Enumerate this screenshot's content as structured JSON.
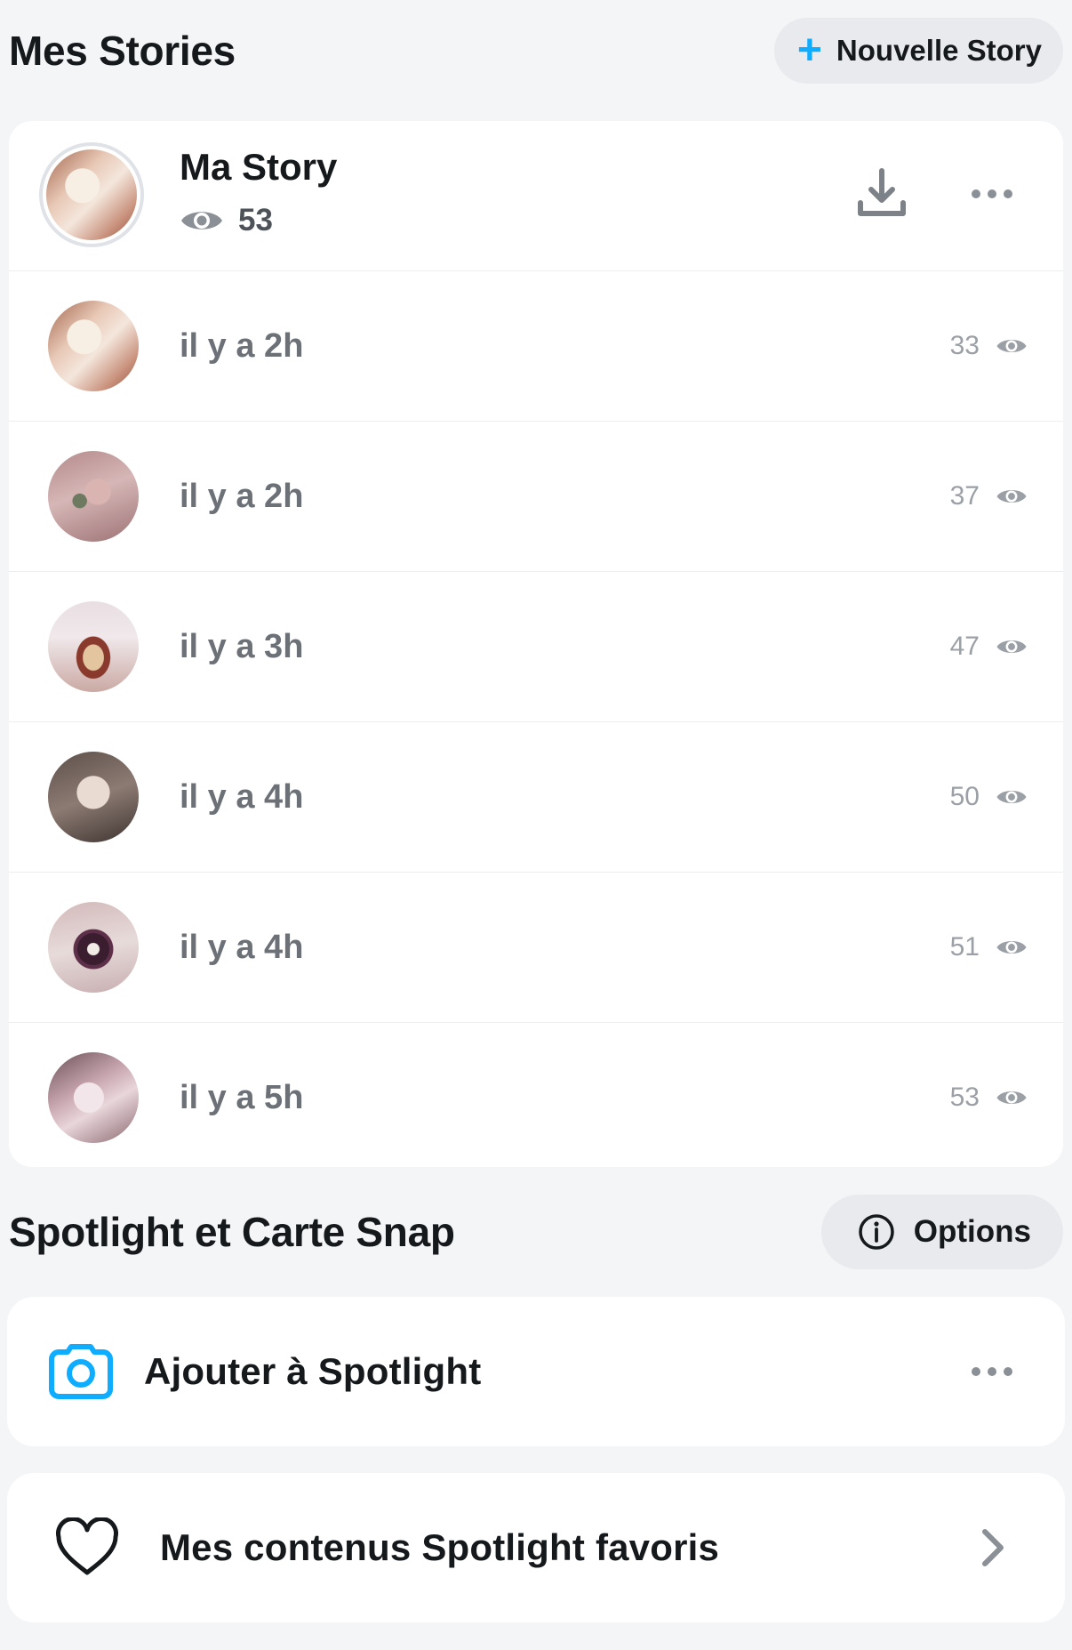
{
  "stories_section": {
    "title": "Mes Stories",
    "new_story_label": "Nouvelle Story"
  },
  "my_story": {
    "name": "Ma Story",
    "views": "53",
    "items": [
      {
        "time": "il y a 2h",
        "views": "33",
        "thumb": "food-a"
      },
      {
        "time": "il y a 2h",
        "views": "37",
        "thumb": "food-b"
      },
      {
        "time": "il y a 3h",
        "views": "47",
        "thumb": "food-c"
      },
      {
        "time": "il y a 4h",
        "views": "50",
        "thumb": "food-d"
      },
      {
        "time": "il y a 4h",
        "views": "51",
        "thumb": "food-e"
      },
      {
        "time": "il y a 5h",
        "views": "53",
        "thumb": "food-f"
      }
    ]
  },
  "spotlight_section": {
    "title": "Spotlight et Carte Snap",
    "options_label": "Options",
    "add_label": "Ajouter à Spotlight",
    "favorites_label": "Mes contenus Spotlight favoris"
  },
  "colors": {
    "accent_blue": "#0fadff",
    "background": "#f4f5f7",
    "card": "#ffffff",
    "muted_text": "#6c7178",
    "icon_grey": "#9ba0a6"
  }
}
